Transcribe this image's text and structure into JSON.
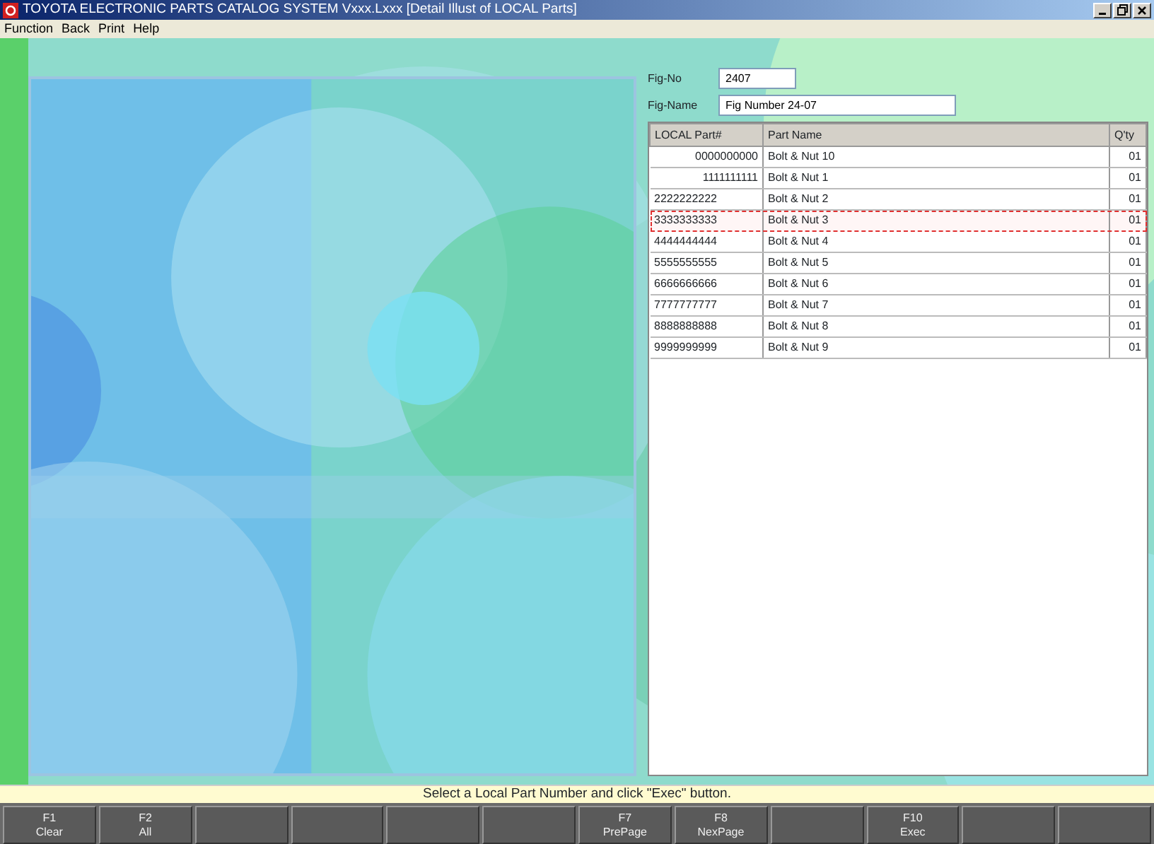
{
  "window": {
    "title": "TOYOTA ELECTRONIC PARTS CATALOG SYSTEM Vxxx.Lxxx [Detail Illust of LOCAL Parts]"
  },
  "menu": [
    "Function",
    "Back",
    "Print",
    "Help"
  ],
  "fig_no": {
    "label": "Fig-No",
    "value": "2407"
  },
  "fig_name": {
    "label": "Fig-Name",
    "value": "Fig Number 24-07"
  },
  "table": {
    "columns": [
      "LOCAL Part#",
      "Part Name",
      "Q'ty"
    ],
    "rows": [
      {
        "part_no": "0000000000",
        "kind": "right_aligned",
        "name": "Bolt & Nut 10",
        "qty": "01",
        "selected": false
      },
      {
        "part_no": "1111111111",
        "kind": "right_aligned",
        "name": "Bolt & Nut 1",
        "qty": "01",
        "selected": false
      },
      {
        "part_no": "2222222222",
        "kind": "left_aligned",
        "name": "Bolt & Nut 2",
        "qty": "01",
        "selected": false
      },
      {
        "part_no": "3333333333",
        "kind": "left_aligned",
        "name": "Bolt & Nut 3",
        "qty": "01",
        "selected": true
      },
      {
        "part_no": "4444444444",
        "kind": "left_aligned",
        "name": "Bolt & Nut 4",
        "qty": "01",
        "selected": false
      },
      {
        "part_no": "5555555555",
        "kind": "left_aligned",
        "name": "Bolt & Nut 5",
        "qty": "01",
        "selected": false
      },
      {
        "part_no": "6666666666",
        "kind": "left_aligned",
        "name": "Bolt & Nut 6",
        "qty": "01",
        "selected": false
      },
      {
        "part_no": "7777777777",
        "kind": "left_aligned",
        "name": "Bolt & Nut 7",
        "qty": "01",
        "selected": false
      },
      {
        "part_no": "8888888888",
        "kind": "left_aligned",
        "name": "Bolt & Nut 8",
        "qty": "01",
        "selected": false
      },
      {
        "part_no": "9999999999",
        "kind": "left_aligned",
        "name": "Bolt & Nut 9",
        "qty": "01",
        "selected": false
      }
    ]
  },
  "status_bar": "Select a Local Part Number and click \"Exec\" button.",
  "function_keys": [
    {
      "kind": "key",
      "key": "F1",
      "label": "Clear"
    },
    {
      "kind": "key",
      "key": "F2",
      "label": "All"
    },
    {
      "kind": "blank"
    },
    {
      "kind": "blank"
    },
    {
      "kind": "blank"
    },
    {
      "kind": "blank"
    },
    {
      "kind": "key",
      "key": "F7",
      "label": "PrePage"
    },
    {
      "kind": "key",
      "key": "F8",
      "label": "NexPage"
    },
    {
      "kind": "blank"
    },
    {
      "kind": "key",
      "key": "F10",
      "label": "Exec"
    },
    {
      "kind": "blank"
    },
    {
      "kind": "blank"
    }
  ]
}
